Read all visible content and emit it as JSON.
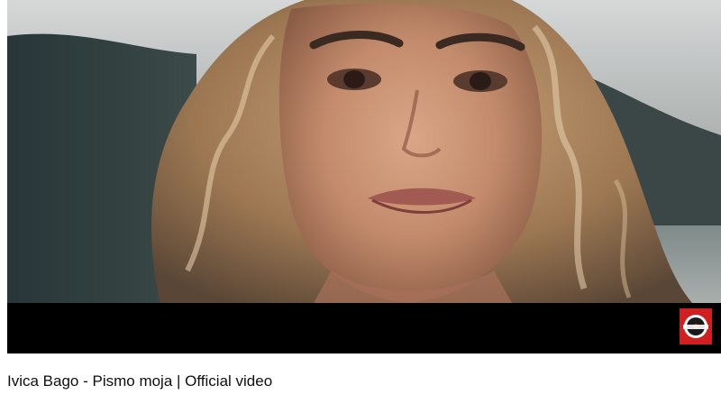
{
  "video": {
    "title": "Ivica Bago - Pismo moja | Official video",
    "thumbnail_description_icon": "video-frame",
    "watermark_icon": "record-label-logo-icon"
  },
  "colors": {
    "background": "#ffffff",
    "player_bar": "#000000",
    "title_text": "#0f0f0f",
    "logo_red": "#d01f1f"
  }
}
